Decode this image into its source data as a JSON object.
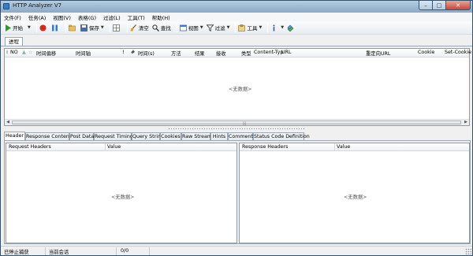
{
  "window": {
    "title": "HTTP Analyzer V7"
  },
  "controls": {
    "minimize": "–",
    "maximize": "□",
    "close": "✕"
  },
  "menu": [
    "文件(F)",
    "任务(A)",
    "视图(V)",
    "表格(G)",
    "过滤(L)",
    "工具(T)",
    "帮助(H)"
  ],
  "toolbar": {
    "start": "开始",
    "save": "保存",
    "clear": "清空",
    "find": "查找",
    "view": "视图",
    "filter": "过滤",
    "tools": "工具"
  },
  "session_tab": "进程",
  "list_columns": [
    "NO",
    "时间偏移",
    "时间轴",
    "!",
    "#",
    "时间(s)",
    "方法",
    "结果",
    "接收",
    "类型",
    "Content-Typ",
    "URL",
    "重定向URL",
    "Cookie",
    "Set-Cookie"
  ],
  "list_empty": "<无数据>",
  "detail_tabs": [
    "Header",
    "Response Content",
    "Post Data",
    "Request Timing",
    "Query String",
    "Cookies",
    "Raw Stream",
    "Hints",
    "Comment",
    "Status Code Definition"
  ],
  "request_pane": {
    "col1": "Request Headers",
    "col2": "Value",
    "empty": "<无数据>"
  },
  "response_pane": {
    "col1": "Response Headers",
    "col2": "Value",
    "empty": "<无数据>"
  },
  "status": {
    "capture": "已停止捕获",
    "session": "当前会话",
    "count": "0/0"
  },
  "colors": {
    "accent": "#3a7cc2",
    "record": "#d42a1e",
    "start": "#2f9a2a"
  },
  "icons": [
    "app-icon",
    "play-icon",
    "record-icon",
    "pause-icon",
    "open-icon",
    "save-icon",
    "grid-icon",
    "clear-icon",
    "find-icon",
    "view-icon",
    "filter-icon",
    "tools-icon",
    "info-icon",
    "plugin-icon",
    "chevron-down-icon"
  ]
}
